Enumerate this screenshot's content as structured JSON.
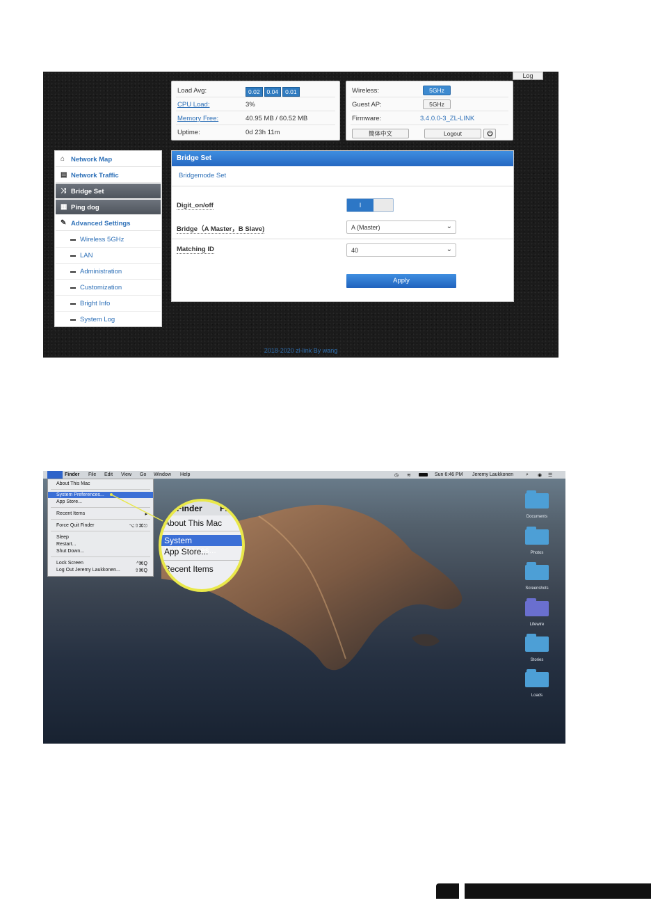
{
  "router": {
    "log_button": "Log",
    "status": {
      "load_avg_label": "Load Avg:",
      "load_avg_values": [
        "0.02",
        "0.04",
        "0.01"
      ],
      "cpu_load_label": "CPU Load:",
      "cpu_load_value": "3%",
      "memory_free_label": "Memory Free:",
      "memory_free_value": "40.95 MB / 60.52 MB",
      "uptime_label": "Uptime:",
      "uptime_value": "0d 23h 11m"
    },
    "wireless_panel": {
      "wireless_label": "Wireless:",
      "wireless_btn": "5GHz",
      "guest_ap_label": "Guest AP:",
      "guest_ap_btn": "5GHz",
      "firmware_label": "Firmware:",
      "firmware_value": "3.4.0.0-3_ZL-LINK",
      "lang_btn": "簡体中文",
      "logout_btn": "Logout",
      "power_icon": "power-icon"
    },
    "sidebar": {
      "items": [
        {
          "label": "Network Map",
          "icon": "home-icon"
        },
        {
          "label": "Network Traffic",
          "icon": "table-icon"
        },
        {
          "label": "Bridge Set",
          "icon": "shuffle-icon"
        },
        {
          "label": "Ping dog",
          "icon": "grid-icon"
        },
        {
          "label": "Advanced Settings",
          "icon": "wrench-icon"
        }
      ],
      "sub_items": [
        "Wireless 5GHz",
        "LAN",
        "Administration",
        "Customization",
        "Bright Info",
        "System Log"
      ]
    },
    "main": {
      "header": "Bridge Set",
      "subheader": "Bridgemode Set",
      "digit_label": "Digit_on/off",
      "toggle_value": "I",
      "bridge_label": "Bridge（A Master，B Slave)",
      "bridge_value": "A (Master)",
      "matching_label": "Matching ID",
      "matching_value": "40",
      "apply_btn": "Apply"
    },
    "footer": "2018-2020 zl-link By wang"
  },
  "mac": {
    "menubar": {
      "items": [
        "Finder",
        "File",
        "Edit",
        "View",
        "Go",
        "Window",
        "Help"
      ],
      "clock": "Sun 6:46 PM",
      "user": "Jeremy Laukkonen"
    },
    "apple_menu": {
      "about": "About This Mac",
      "system_prefs": "System Preferences...",
      "app_store": "App Store...",
      "recent_items": "Recent Items",
      "force_quit": "Force Quit Finder",
      "force_quit_sc": "⌥⇧⌘⎋",
      "sleep": "Sleep",
      "restart": "Restart...",
      "shut_down": "Shut Down...",
      "lock_screen": "Lock Screen",
      "lock_screen_sc": "^⌘Q",
      "log_out": "Log Out Jeremy Laukkonen...",
      "log_out_sc": "⇧⌘Q"
    },
    "magnifier": {
      "finder": "Finder",
      "finder_next": "Fi",
      "about": "About This Mac",
      "system_prefs": "System Preferences...",
      "app_store": "App Store...",
      "recent_items": "Recent Items"
    },
    "desktop_folders": [
      {
        "label": "Documents",
        "color": "#4d9fd6"
      },
      {
        "label": "Photos",
        "color": "#4d9fd6"
      },
      {
        "label": "Screenshots",
        "color": "#4d9fd6"
      },
      {
        "label": "Lifewire",
        "color": "#6a6fcf"
      },
      {
        "label": "Stories",
        "color": "#4d9fd6"
      },
      {
        "label": "Loads",
        "color": "#4d9fd6"
      }
    ],
    "highlight_color": "#3b6fd6",
    "magnifier_ring_color": "#e9e84a"
  }
}
